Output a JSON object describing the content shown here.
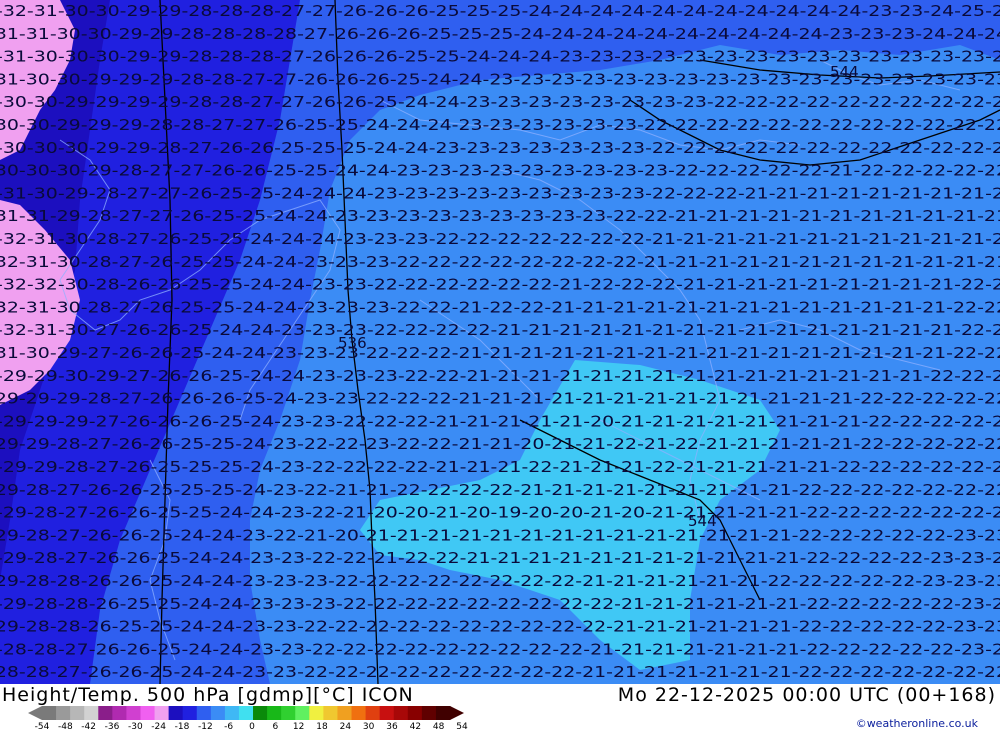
{
  "title": {
    "left": "Height/Temp. 500 hPa [gdmp][°C] ICON",
    "right": "Mo 22-12-2025 00:00 UTC (00+168)"
  },
  "credit": "©weatheronline.co.uk",
  "scale": {
    "ticks": [
      "-54",
      "-48",
      "-42",
      "-36",
      "-30",
      "-24",
      "-18",
      "-12",
      "-6",
      "0",
      "6",
      "12",
      "18",
      "24",
      "30",
      "36",
      "42",
      "48",
      "54"
    ],
    "colors": [
      "#7a7a7a",
      "#9a9a9a",
      "#b7b7b7",
      "#d2d2d2",
      "#8a1e8a",
      "#b02ab0",
      "#d040d0",
      "#f060f0",
      "#f0a0f0",
      "#1c0fbf",
      "#2020e0",
      "#2f5ff0",
      "#3b8cf5",
      "#3fb8f5",
      "#40e0f0",
      "#0a8a0a",
      "#18b818",
      "#30d030",
      "#60f060",
      "#f0f040",
      "#f0c830",
      "#f0a020",
      "#f07010",
      "#e04010",
      "#c81010",
      "#a80808",
      "#880000",
      "#600000",
      "#400000"
    ]
  },
  "map": {
    "region_colors": {
      "very_cold": "#f0a0f0",
      "deep_blue": "#1c0fbf",
      "blue": "#2020e0",
      "mid_blue": "#2f5ff0",
      "light_blue": "#3b8cf5",
      "cyan": "#40c8f5"
    },
    "height_labels": [
      "544",
      "536",
      "544"
    ],
    "isotherm_labels": [
      {
        "row": 0,
        "text": "-32-31-30-30-29-29-28-28-28-27-27-26-26-26-25-25-25-24-24-24-24-24-24-24-24-24-24-24-23-23-24-25-25"
      },
      {
        "row": 1,
        "text": "-31-31-30-30-29-29-28-28-28-28-27-26-26-26-25-25-25-24-24-24-24-24-24-24-24-24-24-23-23-23-24-24-24"
      },
      {
        "row": 2,
        "text": "-31-30-30-30-29-29-28-28-28-27-26-26-26-25-25-24-24-24-23-23-23-23-23-23-23-23-23-23-23-23-23-23-23"
      },
      {
        "row": 3,
        "text": "-31-30-30-29-29-29-28-28-27-27-26-26-26-25-24-24-23-23-23-23-23-23-23-23-23-23-23-23-23-23-23-23-23"
      },
      {
        "row": 4,
        "text": "-30-30-29-29-29-29-28-28-27-27-26-26-25-24-24-23-23-23-23-23-23-23-23-22-22-22-22-22-22-22-22-22-22"
      },
      {
        "row": 5,
        "text": "-30-30-29-29-29-28-28-27-27-26-25-25-24-24-24-23-23-23-23-23-23-22-22-22-22-22-22-22-22-22-22-22-22"
      },
      {
        "row": 6,
        "text": "-30-30-30-29-29-28-27-26-26-25-25-25-24-24-23-23-23-23-23-23-23-22-22-22-22-22-22-22-22-22-22-22-22"
      },
      {
        "row": 7,
        "text": "-30-30-30-29-28-27-27-26-26-25-25-24-24-23-23-23-23-23-23-23-23-23-22-22-22-22-22-21-22-22-22-22-22"
      },
      {
        "row": 8,
        "text": "-31-30-29-28-27-27-26-25-25-24-24-24-23-23-23-23-23-23-23-23-23-22-22-22-21-21-21-21-21-21-21-21-21"
      },
      {
        "row": 9,
        "text": "-31-31-29-28-27-27-26-25-25-24-24-23-23-23-23-23-23-23-23-23-22-22-21-21-21-21-21-21-21-21-21-21-21"
      },
      {
        "row": 10,
        "text": "-32-31-30-28-27-26-25-25-24-24-24-23-23-23-22-22-22-22-22-22-22-21-21-21-21-21-21-21-21-21-21-21-21"
      },
      {
        "row": 11,
        "text": "-32-31-30-28-27-26-25-25-24-24-23-23-23-22-22-22-22-22-22-22-22-21-21-21-21-21-21-21-21-21-21-21-21"
      },
      {
        "row": 12,
        "text": "-32-32-30-28-26-26-25-25-24-24-23-23-22-22-22-22-22-22-21-22-22-22-21-21-21-21-21-21-21-21-21-22-22"
      },
      {
        "row": 13,
        "text": "-32-31-30-28-27-26-25-25-24-24-23-23-23-22-22-21-22-22-21-21-21-21-21-21-21-21-21-21-21-21-21-22-22"
      },
      {
        "row": 14,
        "text": "-32-31-30-27-26-26-25-24-24-23-23-23-22-22-22-22-21-21-21-21-21-21-21-21-21-21-21-21-21-21-21-22-22"
      },
      {
        "row": 15,
        "text": "-31-30-29-27-26-26-25-24-24-23-23-23-22-22-22-21-21-21-21-21-21-21-21-21-21-21-21-21-21-21-21-22-22"
      },
      {
        "row": 16,
        "text": "-29-29-30-29-27-26-26-25-24-24-23-23-23-22-22-21-21-21-21-21-21-21-21-21-21-21-21-21-21-21-22-22-22"
      },
      {
        "row": 17,
        "text": "-29-29-29-28-27-26-26-26-25-24-23-23-22-22-22-21-21-21-21-21-21-21-21-21-21-21-21-21-22-22-22-22-22"
      },
      {
        "row": 18,
        "text": "-29-29-29-27-26-26-26-25-24-23-23-22-22-22-21-21-21-21-21-20-21-21-21-21-21-21-21-21-22-22-22-22-22"
      },
      {
        "row": 19,
        "text": "-29-29-28-27-26-26-25-25-24-23-22-22-23-22-22-21-21-20-21-21-22-21-22-21-21-21-21-21-22-22-22-22-22"
      },
      {
        "row": 20,
        "text": "-29-29-28-27-26-25-25-25-24-23-22-22-22-22-21-21-21-22-21-21-21-22-21-21-21-21-21-22-22-22-22-22-22"
      },
      {
        "row": 21,
        "text": "-29-28-27-26-26-25-25-25-24-23-22-21-21-22-22-22-22-21-21-21-21-21-21-21-21-21-22-22-22-22-22-22-22"
      },
      {
        "row": 22,
        "text": "-29-28-27-26-26-25-25-24-24-23-22-21-20-20-21-20-19-20-20-21-20-21-21-21-21-21-22-22-22-22-22-22-22"
      },
      {
        "row": 23,
        "text": "-29-28-27-26-26-25-24-24-23-22-21-20-21-21-21-21-21-21-21-21-21-21-21-21-21-21-22-22-22-22-22-23-23"
      },
      {
        "row": 24,
        "text": "-29-28-27-26-26-25-24-24-23-23-22-22-21-22-22-21-21-21-21-21-21-21-21-21-21-21-22-22-22-22-23-23-23"
      },
      {
        "row": 25,
        "text": "-29-28-28-26-26-25-24-24-23-23-23-22-22-22-22-22-22-22-22-21-21-21-21-21-21-22-22-22-22-22-23-23-23"
      },
      {
        "row": 26,
        "text": "-29-28-28-26-25-25-24-24-23-23-23-22-22-22-22-22-22-22-22-22-21-21-21-21-21-21-22-22-22-22-22-23-23"
      },
      {
        "row": 27,
        "text": "-29-28-28-26-25-25-24-24-23-23-22-22-22-22-22-22-22-22-22-22-21-21-21-21-21-21-22-22-22-22-22-23-23"
      },
      {
        "row": 28,
        "text": "-28-28-27-26-26-25-24-24-23-23-22-22-22-22-22-22-22-22-22-21-21-21-21-21-21-21-22-22-22-22-22-23-23"
      },
      {
        "row": 29,
        "text": "-28-28-27-26-26-25-24-24-23-23-22-22-22-22-22-22-22-22-22-21-21-21-21-21-21-21-22-22-22-22-22-22-22"
      }
    ]
  }
}
